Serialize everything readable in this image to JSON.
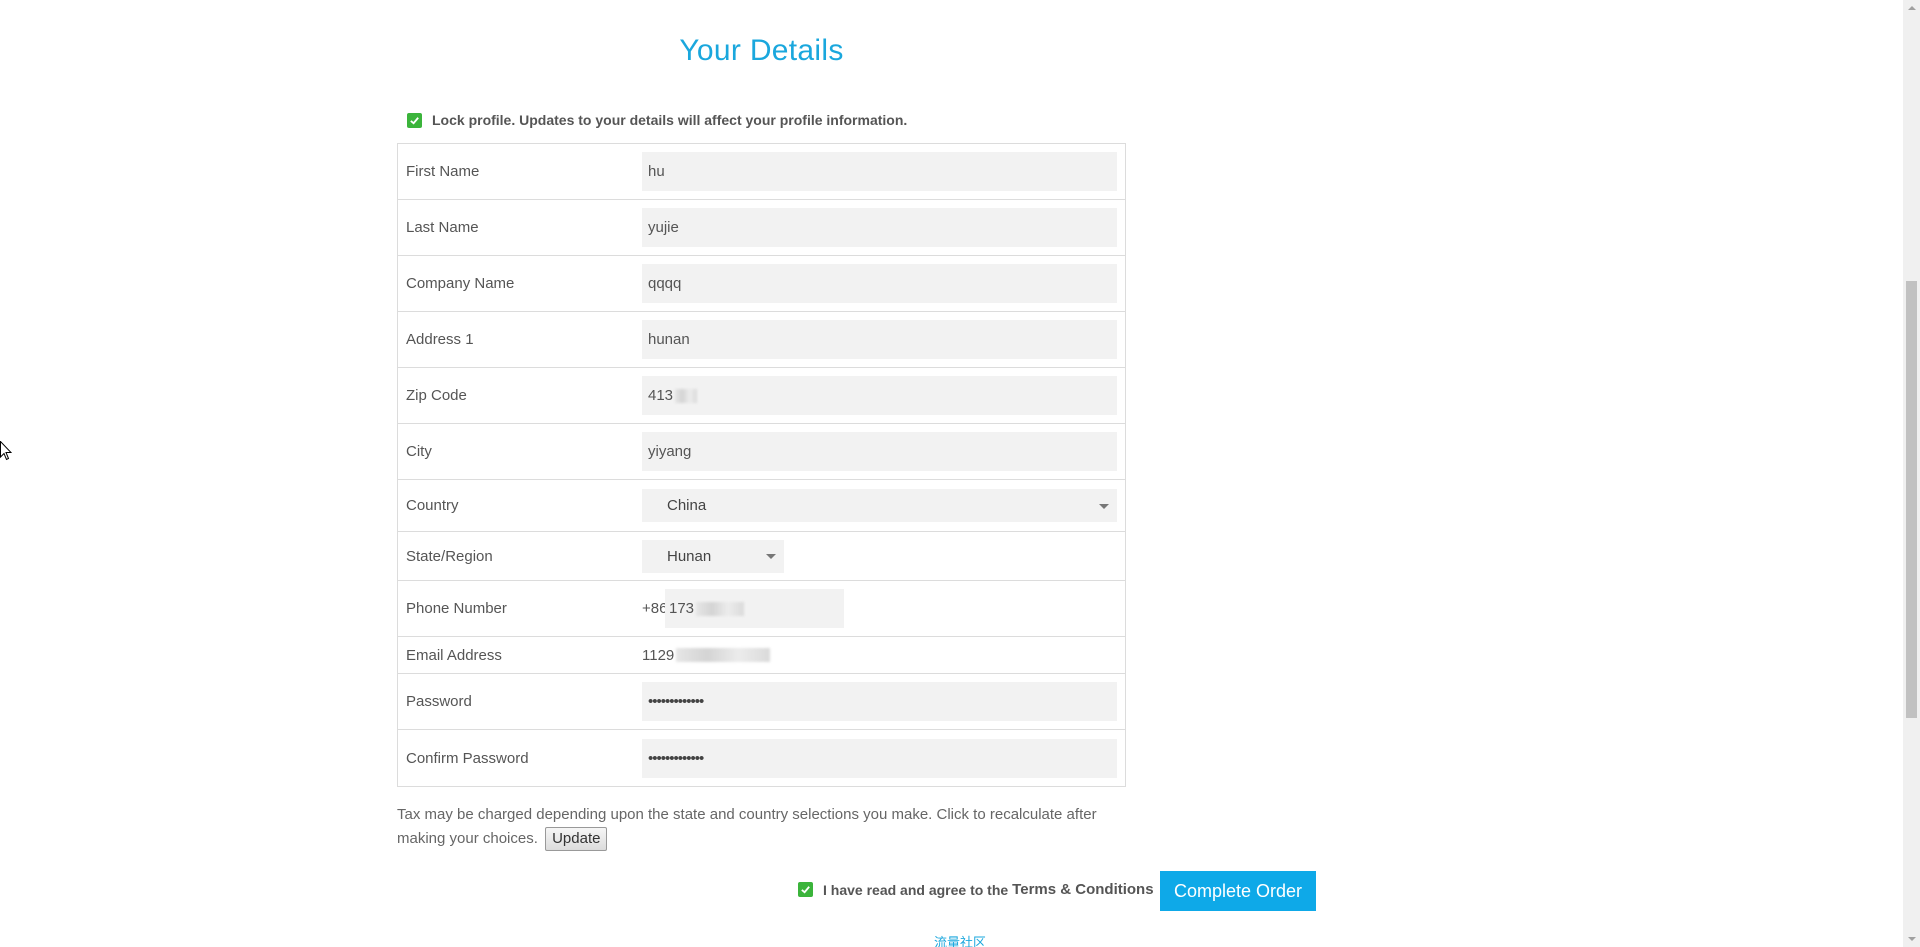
{
  "title": "Your Details",
  "lock_profile": {
    "checked": true,
    "label": "Lock profile. Updates to your details will affect your profile information."
  },
  "fields": {
    "first_name": {
      "label": "First Name",
      "value": "hu"
    },
    "last_name": {
      "label": "Last Name",
      "value": "yujie"
    },
    "company_name": {
      "label": "Company Name",
      "value": "qqqq"
    },
    "address1": {
      "label": "Address 1",
      "value": "hunan"
    },
    "zip_code": {
      "label": "Zip Code",
      "value": "413"
    },
    "city": {
      "label": "City",
      "value": "yiyang"
    },
    "country": {
      "label": "Country",
      "value": "China"
    },
    "state": {
      "label": "State/Region",
      "value": "Hunan"
    },
    "phone": {
      "label": "Phone Number",
      "prefix": "+86",
      "value": "173"
    },
    "email": {
      "label": "Email Address",
      "value": "1129"
    },
    "password": {
      "label": "Password",
      "value": "•••••••••••••"
    },
    "confirm_password": {
      "label": "Confirm Password",
      "value": "•••••••••••••"
    }
  },
  "tax_note": "Tax may be charged depending upon the state and country selections you make. Click to recalculate after making your choices.",
  "update_label": "Update",
  "terms": {
    "checked": true,
    "prefix": "I have read and agree to the",
    "link": "Terms & Conditions"
  },
  "complete_label": "Complete Order",
  "footer_link": "流量社区",
  "colors": {
    "accent": "#1aa7dd",
    "button": "#0ea9e8",
    "check": "#3bb43b"
  }
}
